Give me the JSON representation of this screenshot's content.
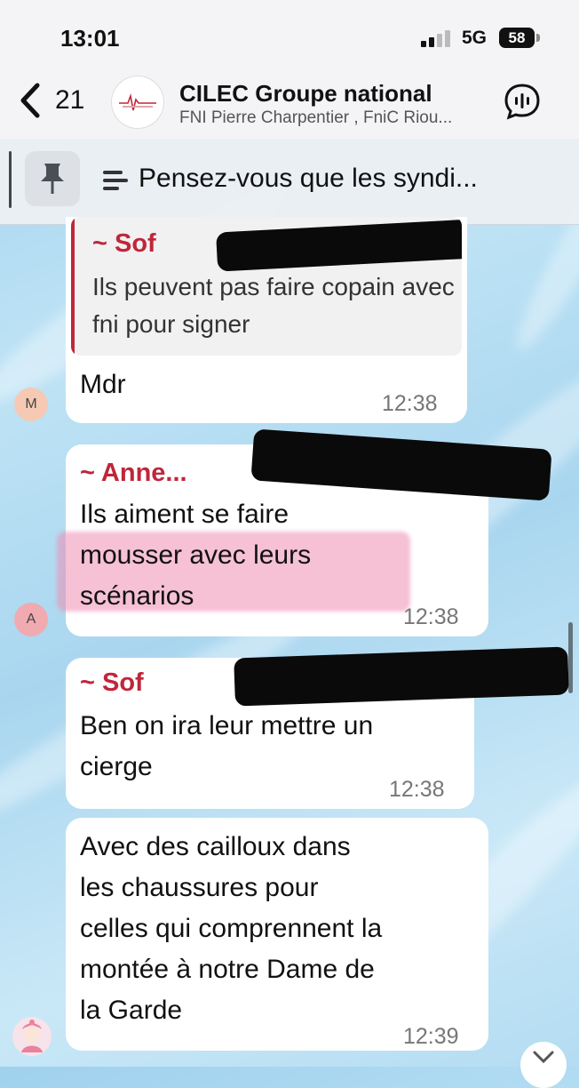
{
  "status_bar": {
    "time": "13:01",
    "network": "5G",
    "battery": "58",
    "signal_bars": 2
  },
  "header": {
    "back_count": "21",
    "title": "CILEC Groupe national",
    "subtitle": "FNI Pierre Charpentier , FniC Riou...",
    "back_icon": "chevron-left-icon",
    "voice_icon": "voice-chat-icon"
  },
  "pinned": {
    "text": "Pensez-vous que les syndi...",
    "pin_icon": "pin-icon",
    "text_icon": "text-lines-icon"
  },
  "messages": [
    {
      "avatar": "M",
      "quote_sender": "~ Sof",
      "quote_text": "Ils peuvent pas faire copain avec fni pour signer",
      "text": "Mdr",
      "time": "12:38"
    },
    {
      "avatar": "A",
      "sender": "~ Anne...",
      "text_line1": "Ils aiment se faire",
      "text_line2": "mousser avec leurs",
      "text_line3": "scénarios",
      "time": "12:38"
    },
    {
      "sender": "~ Sof",
      "text_line1": "Ben on ira leur mettre un",
      "text_line2": "cierge",
      "time": "12:38"
    },
    {
      "text_line1": "Avec des cailloux dans",
      "text_line2": "les chaussures pour",
      "text_line3": "celles qui comprennent la",
      "text_line4": "montée à notre Dame de",
      "text_line5": "la Garde",
      "time": "12:39"
    }
  ],
  "colors": {
    "sender_name": "#c0263a",
    "quote_bar": "#c0263a",
    "highlight": "#ee8cb2",
    "avatar_m": "#f5c9b3",
    "avatar_a": "#f1aab0"
  }
}
